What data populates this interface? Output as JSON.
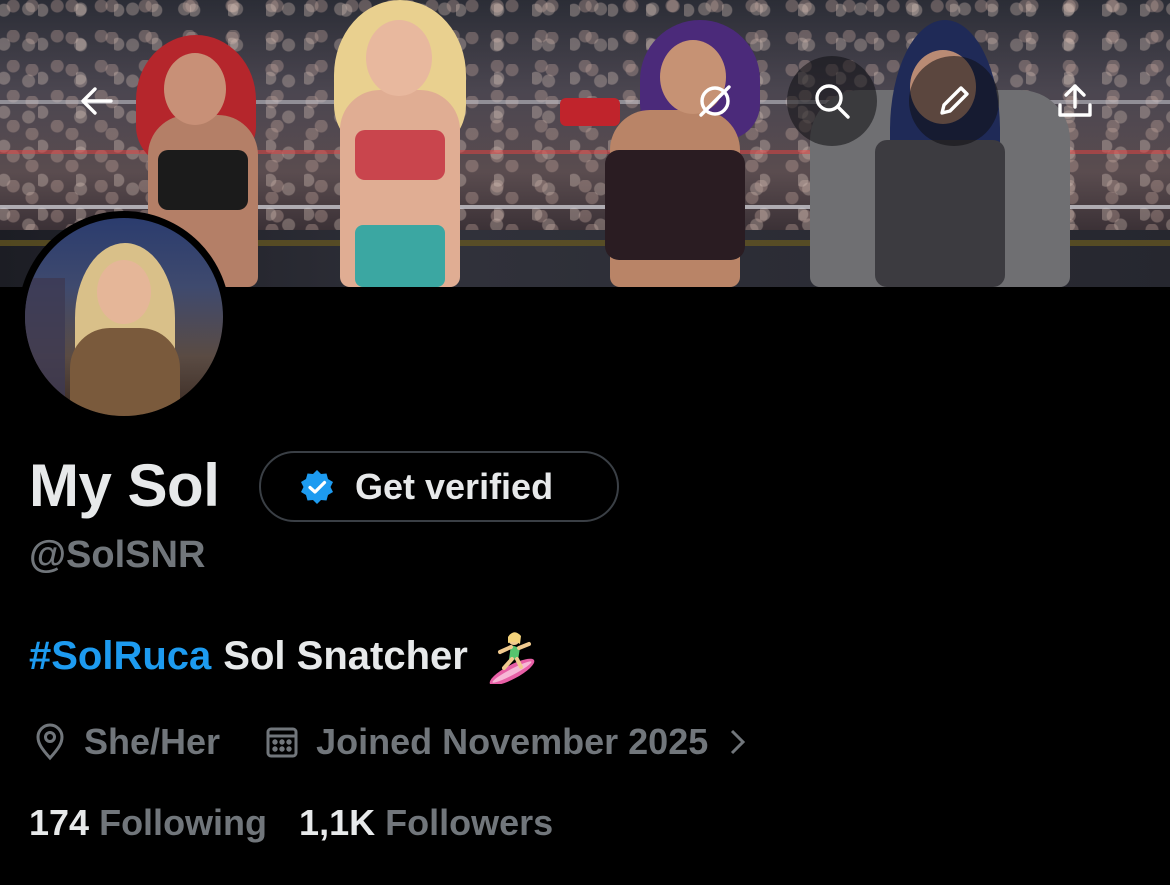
{
  "header": {
    "back_icon": "arrow-left-icon",
    "grok_icon": "slashed-circle-icon",
    "search_icon": "search-icon",
    "edit_icon": "pencil-icon",
    "share_icon": "share-upload-icon"
  },
  "profile": {
    "display_name": "My Sol",
    "verify_button_label": "Get verified",
    "handle": "@SolSNR",
    "bio_hashtag": "#SolRuca",
    "bio_text": "Sol Snatcher",
    "bio_emoji": "surfer-icon",
    "pronouns": "She/Her",
    "joined": "Joined November 2025"
  },
  "stats": {
    "following_count": "174",
    "following_label": "Following",
    "followers_count": "1,1K",
    "followers_label": "Followers"
  },
  "colors": {
    "background": "#000000",
    "text_primary": "#e7e9ea",
    "text_secondary": "#71767b",
    "accent": "#1d9bf0"
  }
}
